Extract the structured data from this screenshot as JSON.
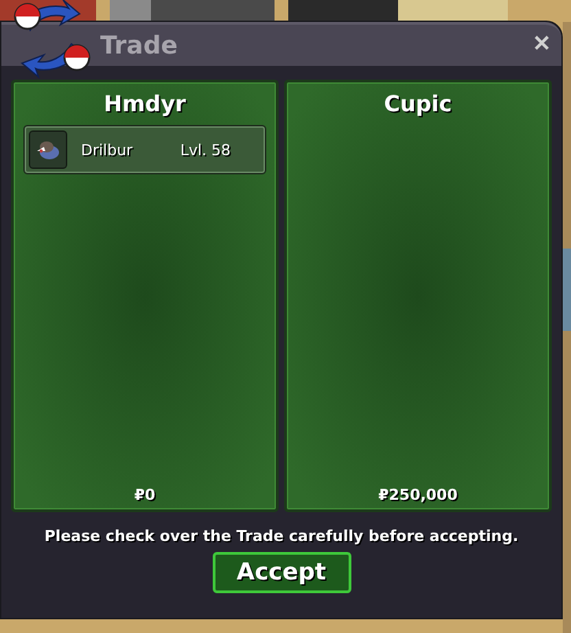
{
  "window": {
    "title": "Trade",
    "close": "✕"
  },
  "sides": [
    {
      "name": "Hmdyr",
      "items": [
        {
          "name": "Drilbur",
          "level": "Lvl. 58"
        }
      ],
      "money": "₽0"
    },
    {
      "name": "Cupic",
      "money": "₽250,000"
    }
  ],
  "message": "Please check over the Trade carefully before accepting.",
  "buttons": [
    "Accept"
  ]
}
